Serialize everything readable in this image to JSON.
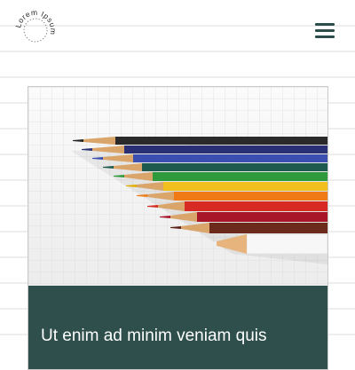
{
  "brand": {
    "logo_text": "Lorem Ipsum",
    "logo_alt": "Lorem Ipsum logo"
  },
  "header": {
    "menu_label": "Menu"
  },
  "card": {
    "image_alt": "Colored pencils lying on grid paper",
    "title": "Ut enim ad minim veniam quis"
  },
  "colors": {
    "accent": "#2c4d4a",
    "card_footer": "#2f4f4c"
  },
  "icons": {
    "menu": "hamburger-menu-icon"
  }
}
